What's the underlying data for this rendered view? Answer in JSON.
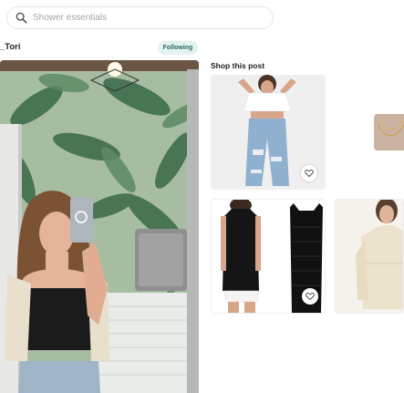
{
  "search": {
    "placeholder": "Shower essentials",
    "icon": "search-icon"
  },
  "post": {
    "username": "_Tori",
    "follow_status": "Following",
    "follow_badge_color": "#e2f3f1",
    "follow_text_color": "#2d6a63"
  },
  "shop": {
    "title": "Shop this post",
    "products": [
      {
        "name": "product-white-tee-ripped-jeans",
        "icon": "heart-icon"
      },
      {
        "name": "product-gold-necklace"
      },
      {
        "name": "product-black-tank-tops",
        "icon": "heart-icon"
      },
      {
        "name": "product-cream-knit-set"
      }
    ]
  }
}
